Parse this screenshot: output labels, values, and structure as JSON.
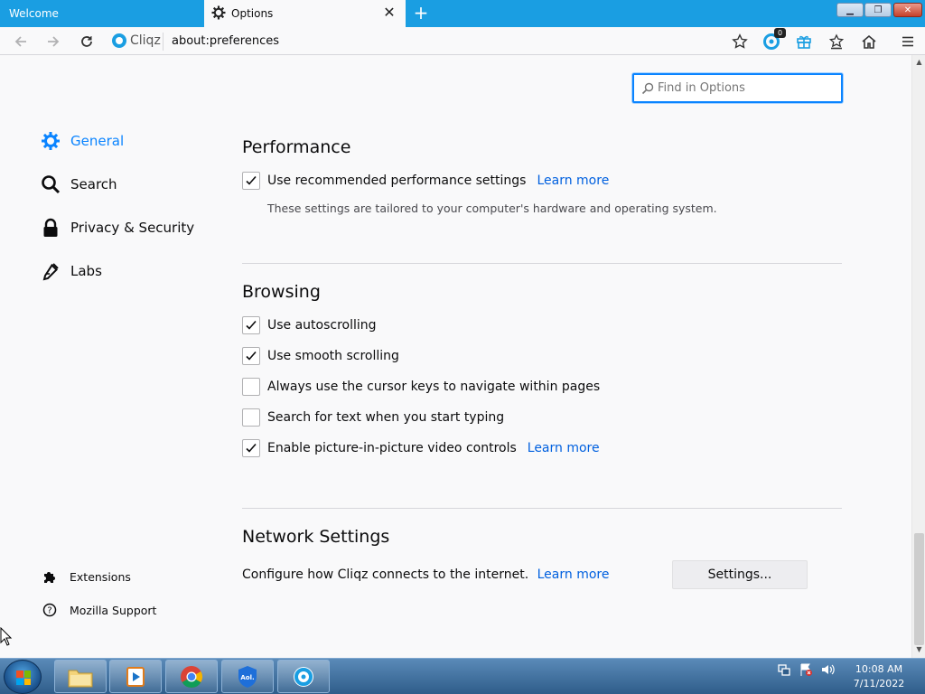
{
  "tabs": {
    "welcome": "Welcome",
    "options": "Options"
  },
  "navbar": {
    "brand": "Cliqz",
    "url": "about:preferences",
    "badge_count": "0"
  },
  "find": {
    "placeholder": "Find in Options"
  },
  "sidebar": {
    "items": [
      {
        "label": "General",
        "icon": "gear-icon",
        "active": true
      },
      {
        "label": "Search",
        "icon": "search-icon",
        "active": false
      },
      {
        "label": "Privacy & Security",
        "icon": "lock-icon",
        "active": false
      },
      {
        "label": "Labs",
        "icon": "pipette-icon",
        "active": false
      }
    ],
    "footer": [
      {
        "label": "Extensions",
        "icon": "puzzle-icon"
      },
      {
        "label": "Mozilla Support",
        "icon": "help-icon"
      }
    ]
  },
  "performance": {
    "heading": "Performance",
    "recommended": {
      "label": "Use recommended performance settings",
      "checked": true,
      "link": "Learn more"
    },
    "description": "These settings are tailored to your computer's hardware and operating system."
  },
  "browsing": {
    "heading": "Browsing",
    "options": [
      {
        "label": "Use autoscrolling",
        "checked": true
      },
      {
        "label": "Use smooth scrolling",
        "checked": true
      },
      {
        "label": "Always use the cursor keys to navigate within pages",
        "checked": false
      },
      {
        "label": "Search for text when you start typing",
        "checked": false
      },
      {
        "label": "Enable picture-in-picture video controls",
        "checked": true,
        "link": "Learn more"
      }
    ]
  },
  "network": {
    "heading": "Network Settings",
    "description": "Configure how Cliqz connects to the internet.",
    "link": "Learn more",
    "button": "Settings..."
  },
  "taskbar": {
    "time": "10:08 AM",
    "date": "7/11/2022"
  },
  "colors": {
    "accent": "#0a84ff",
    "link": "#0060df",
    "titlebar": "#1a9ee2"
  }
}
